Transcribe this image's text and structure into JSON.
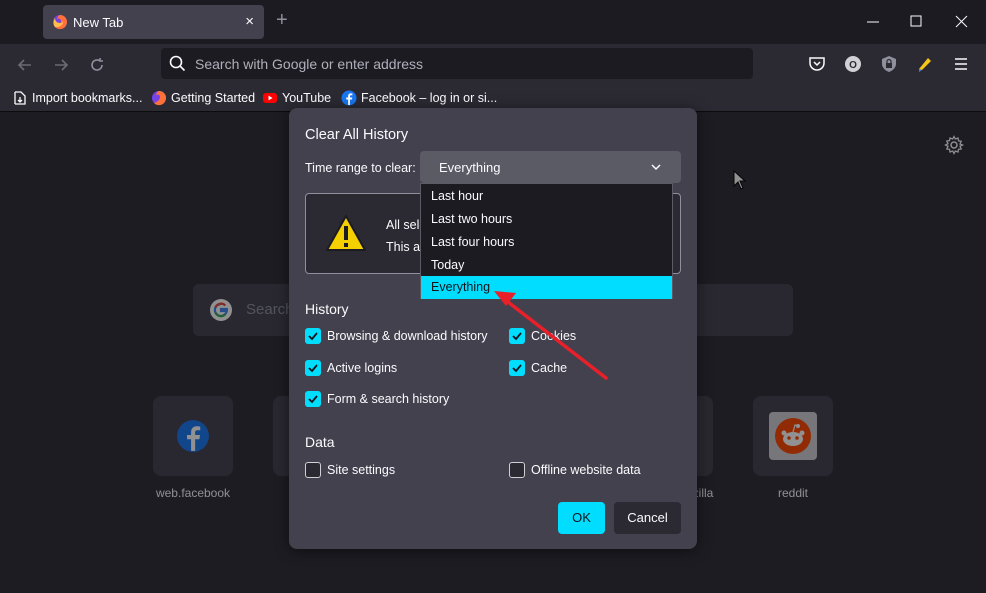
{
  "tab": {
    "title": "New Tab",
    "close": "×"
  },
  "new_tab_button": "+",
  "urlbar": {
    "placeholder": "Search with Google or enter address"
  },
  "bookmarks": [
    {
      "label": "Import bookmarks...",
      "icon": "import-icon"
    },
    {
      "label": "Getting Started",
      "icon": "firefox-icon"
    },
    {
      "label": "YouTube",
      "icon": "youtube-icon"
    },
    {
      "label": "Facebook – log in or si...",
      "icon": "facebook-icon"
    }
  ],
  "newtab_page": {
    "search_placeholder": "Search",
    "tiles": [
      {
        "label": "web.facebook",
        "icon": "facebook-icon"
      },
      {
        "label": "zilla",
        "icon": ""
      },
      {
        "label": "reddit",
        "icon": "reddit-icon"
      }
    ]
  },
  "dialog": {
    "title": "Clear All History",
    "time_range_label": "Time range to clear:",
    "time_range_value": "Everything",
    "warning_line1": "All sele",
    "warning_line2": "This ac",
    "history_heading": "History",
    "history_items": [
      {
        "label": "Browsing & download history",
        "checked": true
      },
      {
        "label": "Cookies",
        "checked": true
      },
      {
        "label": "Active logins",
        "checked": true
      },
      {
        "label": "Cache",
        "checked": true
      },
      {
        "label": "Form & search history",
        "checked": true
      }
    ],
    "data_heading": "Data",
    "data_items": [
      {
        "label": "Site settings",
        "checked": false
      },
      {
        "label": "Offline website data",
        "checked": false
      }
    ],
    "ok_label": "OK",
    "cancel_label": "Cancel"
  },
  "dropdown": {
    "options": [
      "Last hour",
      "Last two hours",
      "Last four hours",
      "Today",
      "Everything"
    ],
    "selected": "Everything"
  },
  "colors": {
    "accent": "#00ddff",
    "arrow": "#e8202a",
    "dialog_bg": "#42414d",
    "page_bg": "#2b2a33"
  }
}
